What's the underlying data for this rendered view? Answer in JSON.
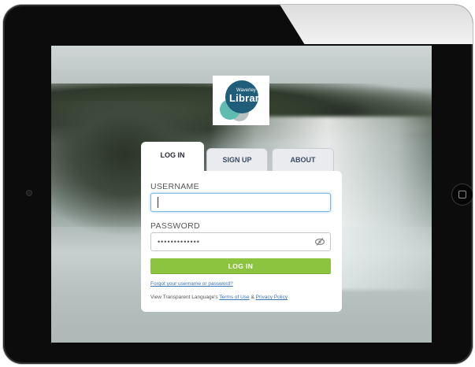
{
  "logo": {
    "line1": "Waverley",
    "line2": "Library",
    "colors": {
      "primary": "#1f5d7a",
      "secondary": "#5fbcb0",
      "tertiary": "#b9c0c2"
    }
  },
  "tabs": [
    {
      "label": "LOG IN",
      "active": true
    },
    {
      "label": "SIGN UP",
      "active": false
    },
    {
      "label": "ABOUT",
      "active": false
    }
  ],
  "form": {
    "username_label": "USERNAME",
    "username_value": "",
    "password_label": "PASSWORD",
    "password_value": "•••••••••••••",
    "password_toggle_icon": "eye-slash-icon",
    "submit_label": "LOG IN",
    "forgot_link": "Forgot your username or password?",
    "terms_prefix": "View Transparent Language's",
    "terms_link": "Terms of Use",
    "terms_and": "&",
    "privacy_link": "Privacy Policy"
  },
  "colors": {
    "accent": "#8cc43f",
    "link": "#3b73b8",
    "focus": "#7fb7dd",
    "tab_text": "#3b4c66"
  }
}
